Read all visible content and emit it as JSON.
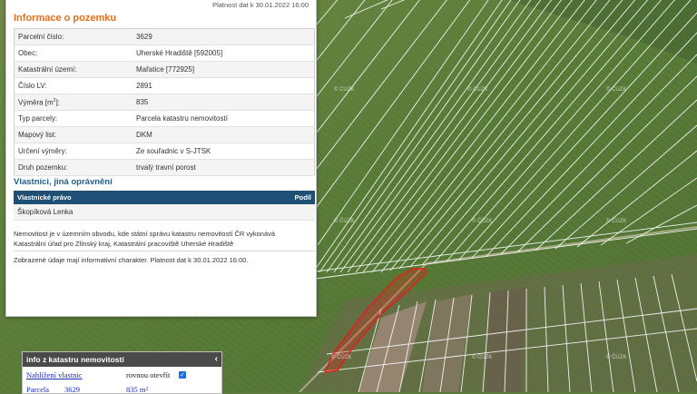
{
  "header": {
    "top_validity_cut": "Platnost dat k 30.01.2022 16:00",
    "title": "Informace o pozemku"
  },
  "parcel_info": [
    {
      "label": "Parcelní číslo:",
      "value": "3629"
    },
    {
      "label": "Obec:",
      "value": "Uherské Hradiště [592005]"
    },
    {
      "label": "Katastrální území:",
      "value": "Mařatice [772925]"
    },
    {
      "label": "Číslo LV:",
      "value": "2891"
    },
    {
      "label": "Výměra [m",
      "label_sup": "2",
      "label_end": "]:",
      "value": "835"
    },
    {
      "label": "Typ parcely:",
      "value": "Parcela katastru nemovitostí"
    },
    {
      "label": "Mapový list:",
      "value": "DKM"
    },
    {
      "label": "Určení výměry:",
      "value": "Ze souřadnic v S-JTSK"
    },
    {
      "label": "Druh pozemku:",
      "value": "trvalý travní porost"
    }
  ],
  "ownership": {
    "title": "Vlastníci, jiná oprávnění",
    "col_right": "Vlastnické právo",
    "col_share": "Podíl",
    "owner": "Škopíková Lenka"
  },
  "notice": {
    "text": "Nemovitost je v územním obvodu, kde státní správu katastru nemovitostí ČR vykonává Katastrální úřad pro Zlínský kraj, Katastrální pracoviště Uherské Hradiště",
    "validity": "Zobrazené údaje mají informativní charakter. Platnost dat k 30.01.2022 16:00."
  },
  "widget": {
    "title": "info z katastru nemovitostí",
    "collapse_icon": "chevron-left-icon",
    "link_view": "Nahlížení vlastnic",
    "open_directly": "rovnou otevřít",
    "checkbox_checked": true,
    "row2_label": "Parcela",
    "row2_number": "3629",
    "row2_area": "835 m²"
  },
  "map": {
    "watermark": "© ČÚZK",
    "colors": {
      "field": "#5d7b3d",
      "parcel_lines": "#ffffff",
      "highlight": "#e0201a"
    }
  }
}
